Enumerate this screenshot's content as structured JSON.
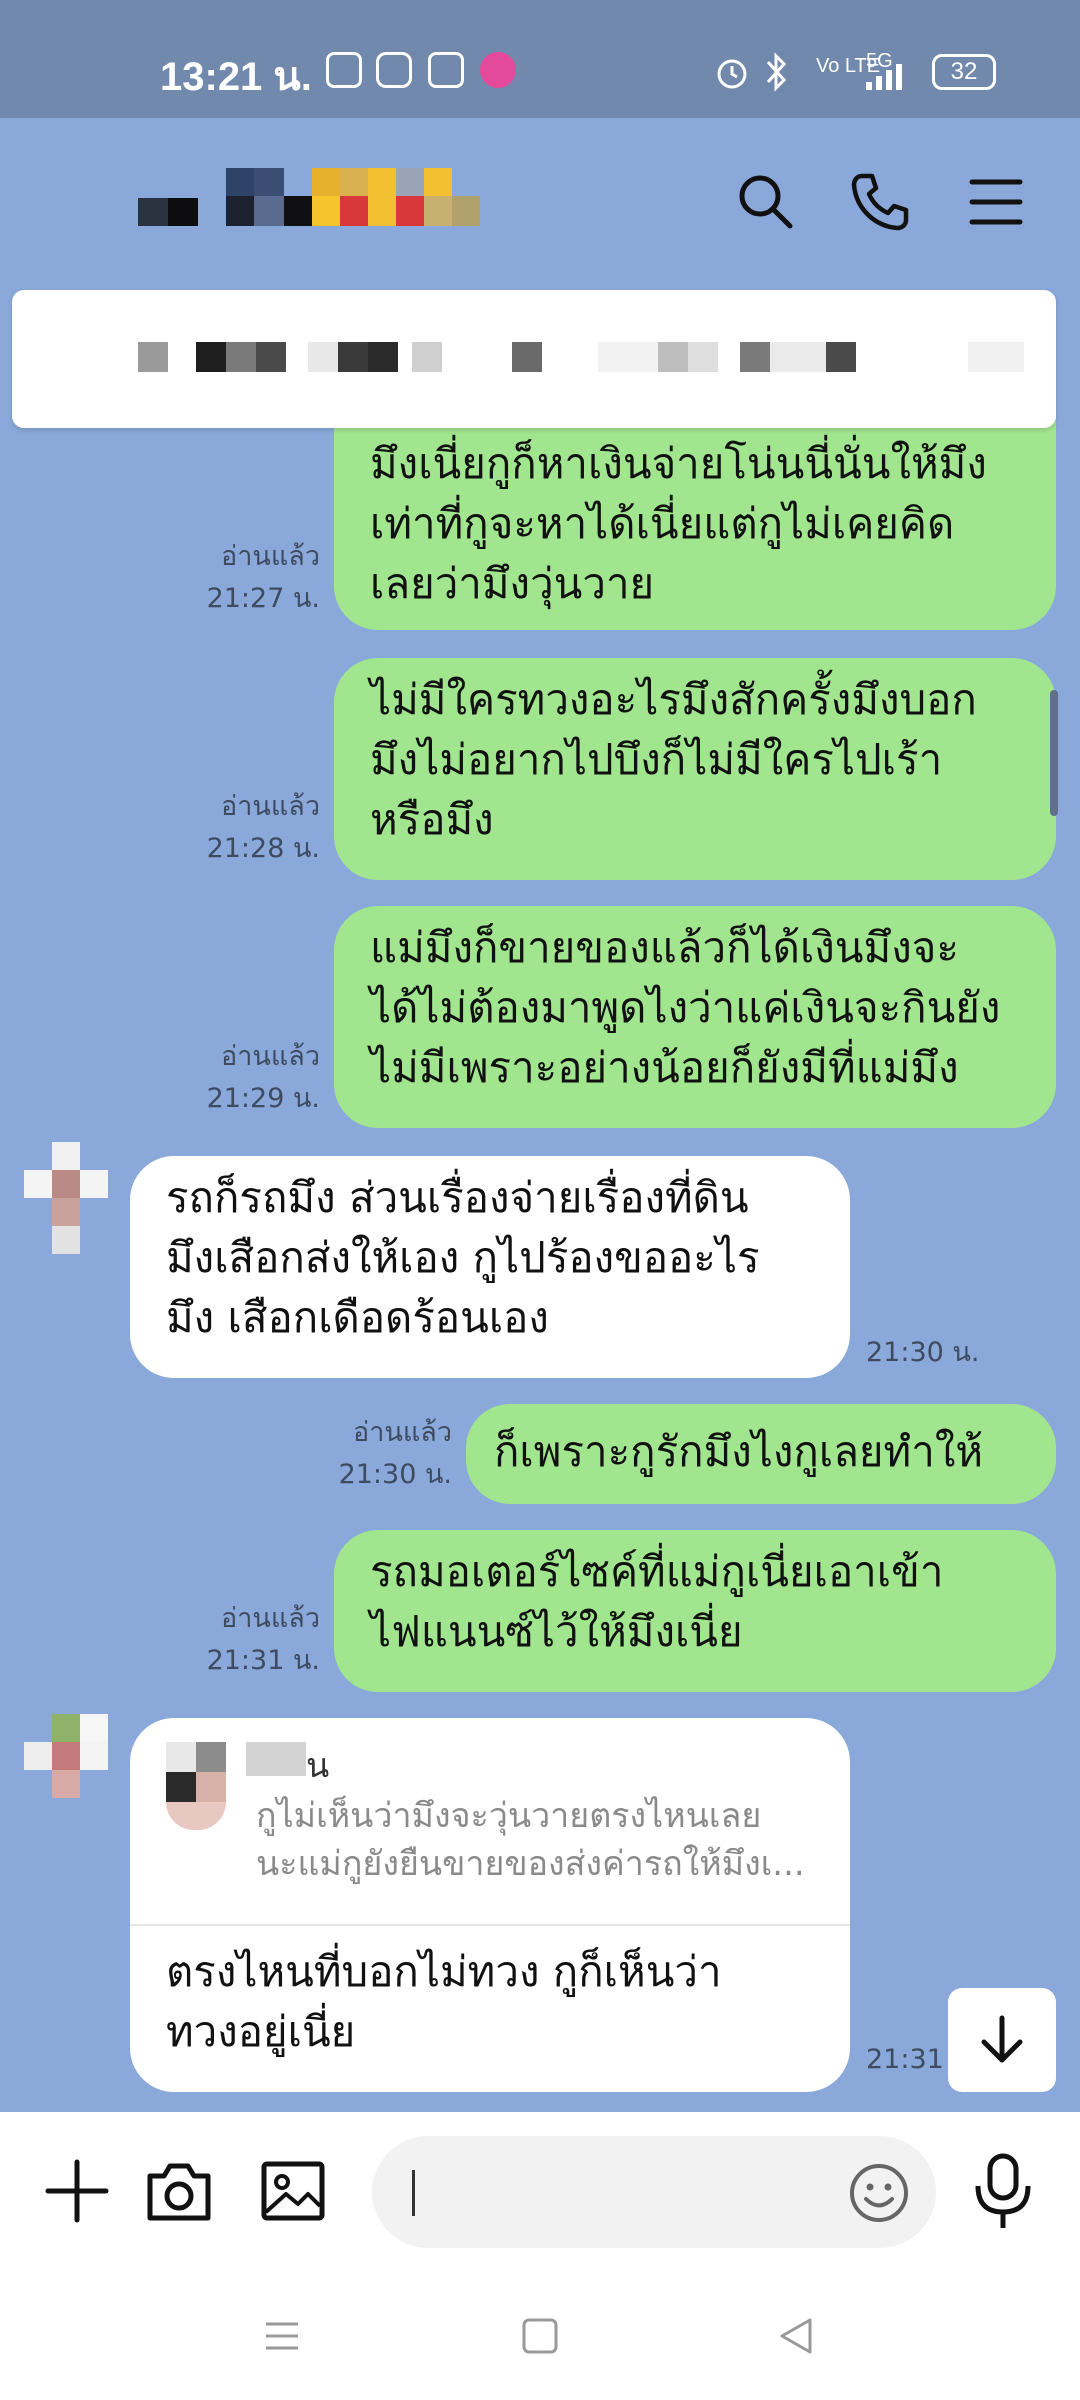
{
  "status_bar": {
    "time": "13:21 น.",
    "battery": "32",
    "network": "5G",
    "volte": "Vo LTE"
  },
  "pinned_banner": {
    "content": "redacted"
  },
  "messages": [
    {
      "type": "sent",
      "text_lines": [
        "มึงเนี่ยกูก็หาเงินจ่ายโน่นนี่นั่นให้มึง",
        "เท่าที่กูจะหาได้เนี่ยแต่กูไม่เคยคิด",
        "เลยว่ามึงวุ่นวาย"
      ],
      "read": "อ่านแล้ว",
      "time": "21:27 น."
    },
    {
      "type": "sent",
      "text_lines": [
        "ไม่มีใครทวงอะไรมึงสักครั้งมึงบอก",
        "มึงไม่อยากไปบึงก็ไม่มีใครไปเร้า",
        "หรือมึง"
      ],
      "read": "อ่านแล้ว",
      "time": "21:28 น."
    },
    {
      "type": "sent",
      "text_lines": [
        "แม่มึงก็ขายของแล้วก็ได้เงินมึงจะ",
        "ได้ไม่ต้องมาพูดไงว่าแค่เงินจะกินยัง",
        "ไม่มีเพราะอย่างน้อยก็ยังมีที่แม่มึง"
      ],
      "read": "อ่านแล้ว",
      "time": "21:29 น."
    },
    {
      "type": "received",
      "text_lines": [
        "รถก็รถมึง ส่วนเรื่องจ่ายเรื่องที่ดิน",
        "มึงเสือกส่งให้เอง กูไปร้องขออะไร",
        "มึง เสือกเดือดร้อนเอง"
      ],
      "time": "21:30 น."
    },
    {
      "type": "sent",
      "text_lines": [
        "ก็เพราะกูรักมึงไงกูเลยทำให้"
      ],
      "read": "อ่านแล้ว",
      "time": "21:30 น."
    },
    {
      "type": "sent",
      "text_lines": [
        "รถมอเตอร์ไซค์ที่แม่กูเนี่ยเอาเข้า",
        "ไฟแนนซ์ไว้ให้มึงเนี่ย"
      ],
      "read": "อ่านแล้ว",
      "time": "21:31 น."
    },
    {
      "type": "received_reply",
      "quote_name_suffix": "น",
      "quote_lines": [
        "กูไม่เห็นว่ามึงจะวุ่นวายตรงไหนเลย",
        "นะแม่กูยังยืนขายของส่งค่ารถให้มึงเ..."
      ],
      "text_lines": [
        "ตรงไหนที่บอกไม่ทวง กูก็เห็นว่า",
        "ทวงอยู่เนี่ย"
      ],
      "time": "21:31"
    }
  ],
  "input": {
    "placeholder": ""
  },
  "colors": {
    "chat_background": "#8aa9da",
    "sent_bubble": "#a1e68f",
    "received_bubble": "#ffffff",
    "status_bar": "#7189ac"
  },
  "icons": {
    "header": [
      "search-icon",
      "phone-icon",
      "menu-icon"
    ],
    "input_bar": [
      "plus-icon",
      "camera-icon",
      "image-icon",
      "emoji-icon",
      "microphone-icon"
    ],
    "nav": [
      "recents-icon",
      "home-icon",
      "back-icon"
    ]
  }
}
